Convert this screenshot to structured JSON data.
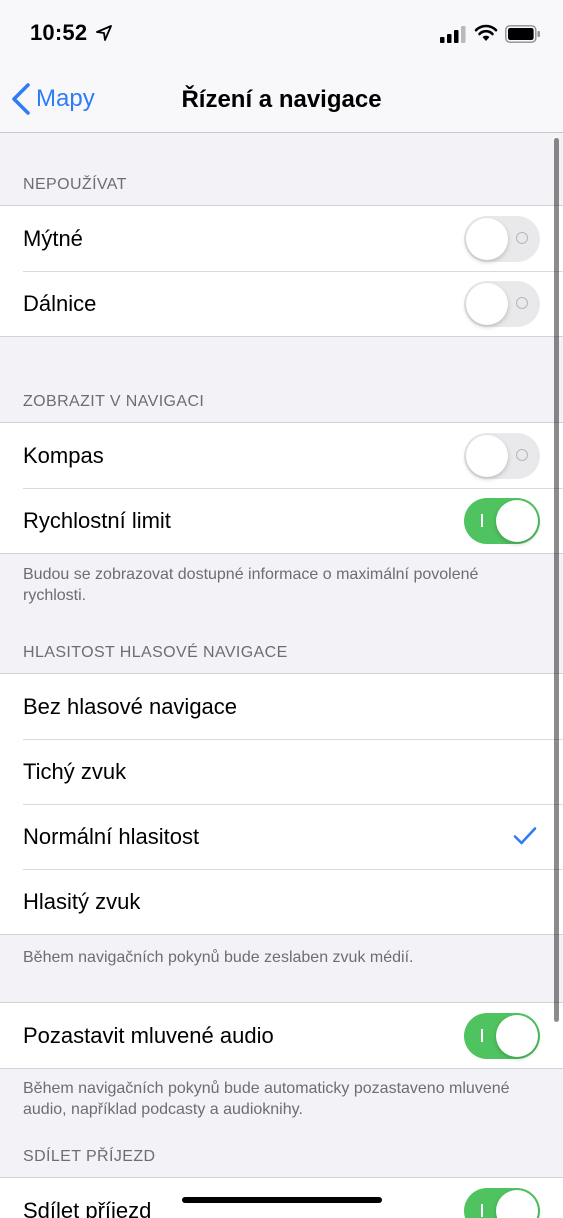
{
  "status_bar": {
    "time": "10:52"
  },
  "nav": {
    "back_label": "Mapy",
    "title": "Řízení a navigace"
  },
  "sections": {
    "avoid": {
      "header": "NEPOUŽÍVAT",
      "items": [
        {
          "label": "Mýtné",
          "toggle": "off"
        },
        {
          "label": "Dálnice",
          "toggle": "off"
        }
      ]
    },
    "show_in_navigation": {
      "header": "ZOBRAZIT V NAVIGACI",
      "items": [
        {
          "label": "Kompas",
          "toggle": "off"
        },
        {
          "label": "Rychlostní limit",
          "toggle": "on"
        }
      ],
      "footer": "Budou se zobrazovat dostupné informace o maximální povolené rychlosti."
    },
    "voice_volume": {
      "header": "HLASITOST HLASOVÉ NAVIGACE",
      "items": [
        {
          "label": "Bez hlasové navigace",
          "selected": false
        },
        {
          "label": "Tichý zvuk",
          "selected": false
        },
        {
          "label": "Normální hlasitost",
          "selected": true
        },
        {
          "label": "Hlasitý zvuk",
          "selected": false
        }
      ],
      "footer": "Během navigačních pokynů bude zeslaben zvuk médií."
    },
    "pause_audio": {
      "items": [
        {
          "label": "Pozastavit mluvené audio",
          "toggle": "on"
        }
      ],
      "footer": "Během navigačních pokynů bude automaticky pozastaveno mluvené audio, například podcasty a audioknihy."
    },
    "share_eta": {
      "header": "SDÍLET PŘÍJEZD",
      "items": [
        {
          "label": "Sdílet příjezd",
          "toggle": "on"
        }
      ]
    }
  },
  "colors": {
    "accent": "#2f7cf6",
    "toggle_on": "#4fc35f",
    "toggle_off": "#e9e9eb",
    "background": "#f2f2f7"
  }
}
